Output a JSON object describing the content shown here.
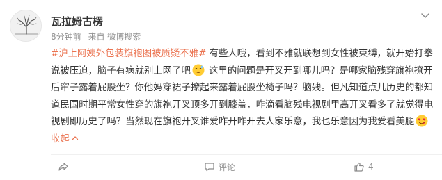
{
  "user": {
    "name": "瓦拉姆古楞",
    "time": "8分钟前",
    "source": "来自 微博搜索",
    "avatar_icon": "tree-avatar"
  },
  "post": {
    "hashtag": "#沪上阿姨外包装旗袍图被质疑不雅#",
    "segment_1": " 有些人哦，看到不雅就联想到女性被束缚，就开始打拳说被压迫，脑子有病就别上网了吧",
    "emoji_1": "awkward-emoji",
    "segment_2": " 这里的问题是开叉开到哪儿吗？是哪家脑残穿旗袍撩开后帘子露着屁股坐？你他妈穿裙子撩起来露着屁股坐椅子吗？脑残。但凡知道点儿历史的都知道民国时期平常女性穿的旗袍开叉顶多开到膝盖，咋滴看脑残电视剧里高开叉看多了就觉得电视剧即历史了吗？当然现在旗袍开叉谁爱咋开咋开去人家乐意，我也乐意因为我爱看美腿",
    "emoji_2": "heart-eyes-emoji",
    "collapse_label": "收起",
    "collapse_icon": "chevron-up-icon"
  },
  "actions": {
    "share_icon": "share-icon",
    "share_label": "",
    "comment_icon": "comment-icon",
    "comment_label": "评论",
    "like_icon": "thumbs-up-icon",
    "like_count": "4"
  },
  "colors": {
    "accent": "#eb7350",
    "meta": "#939393",
    "text": "#333333"
  }
}
